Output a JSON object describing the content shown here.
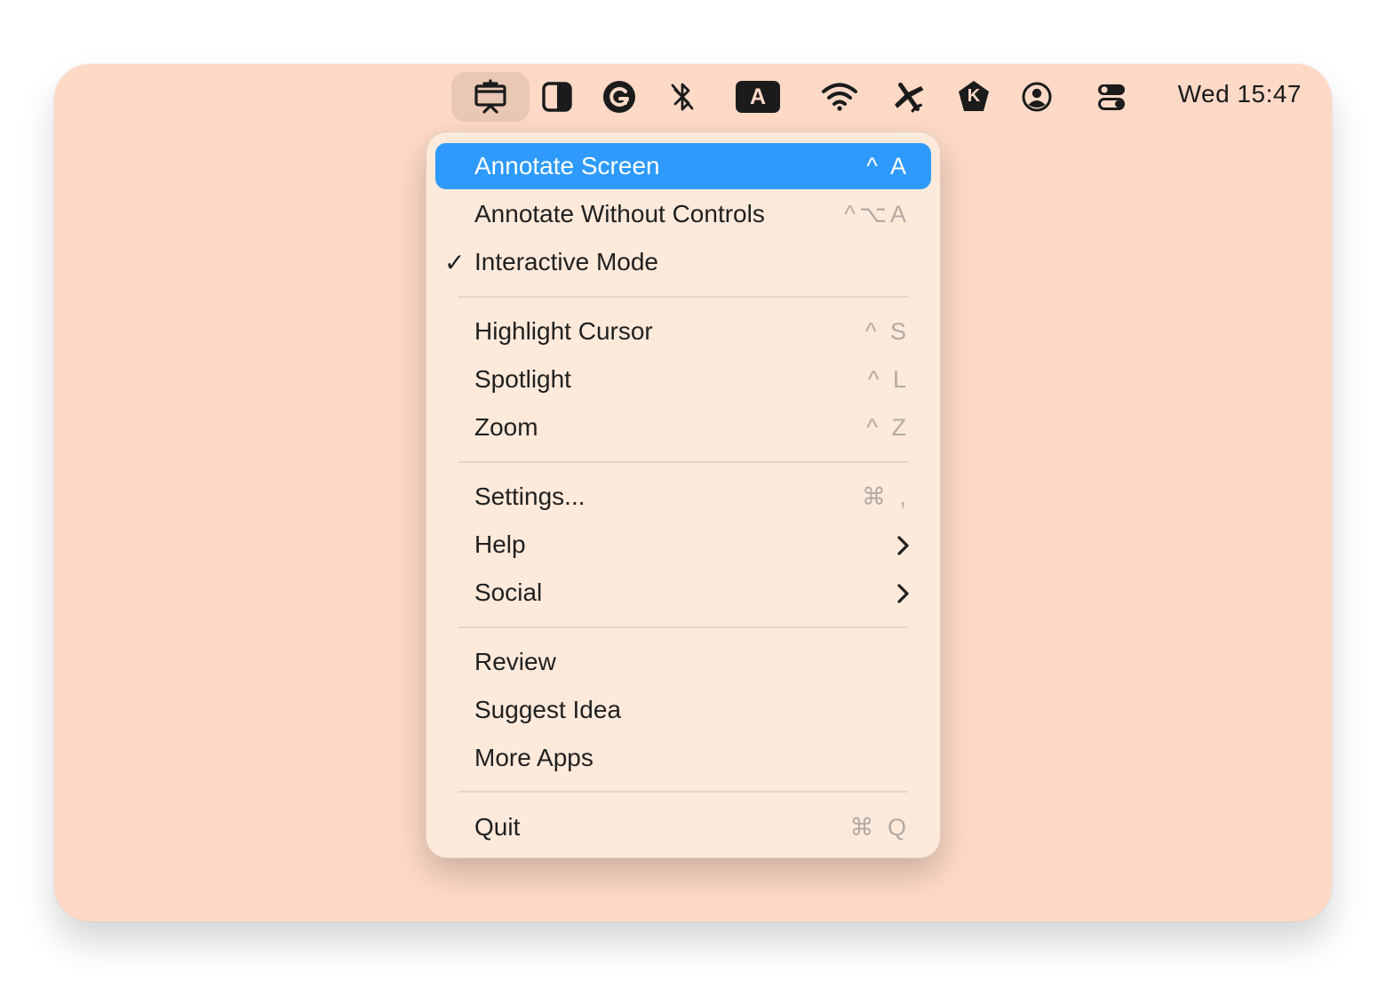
{
  "menubar": {
    "clock": "Wed 15:47",
    "icons": [
      "presentation-icon",
      "contrast-icon",
      "grammarly-icon",
      "bluetooth-off-icon",
      "keyboard-input-icon",
      "wifi-icon",
      "airplane-icon",
      "k-app-icon",
      "user-account-icon",
      "control-center-icon"
    ],
    "input_letter": "A",
    "k_letter": "K"
  },
  "menu": {
    "items": [
      {
        "label": "Annotate Screen",
        "shortcut": "^ A",
        "selected": true
      },
      {
        "label": "Annotate Without Controls",
        "shortcut": "^⌥A"
      },
      {
        "label": "Interactive Mode",
        "checked": true,
        "check": "✓"
      },
      {
        "label": "Highlight Cursor",
        "shortcut": "^ S"
      },
      {
        "label": "Spotlight",
        "shortcut": "^ L"
      },
      {
        "label": "Zoom",
        "shortcut": "^ Z"
      },
      {
        "label": "Settings...",
        "shortcut": "⌘ ,"
      },
      {
        "label": "Help",
        "submenu": true
      },
      {
        "label": "Social",
        "submenu": true
      },
      {
        "label": "Review"
      },
      {
        "label": "Suggest Idea"
      },
      {
        "label": "More Apps"
      },
      {
        "label": "Quit",
        "shortcut": "⌘ Q"
      }
    ]
  },
  "colors": {
    "desktop": "#fdd9c6",
    "menu_bg": "#feeadb",
    "selection": "#2e9afe"
  }
}
